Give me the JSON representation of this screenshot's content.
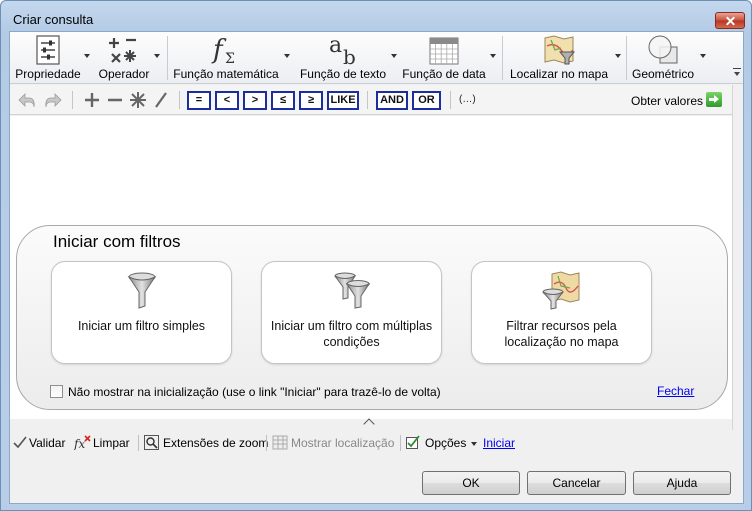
{
  "window": {
    "title": "Criar consulta"
  },
  "ribbon": {
    "items": [
      {
        "label": "Propriedade"
      },
      {
        "label": "Operador"
      },
      {
        "label": "Função matemática"
      },
      {
        "label": "Função de texto"
      },
      {
        "label": "Função de data"
      },
      {
        "label": "Localizar no mapa"
      },
      {
        "label": "Geométrico"
      }
    ]
  },
  "toolbar": {
    "operators": [
      "=",
      "<",
      ">",
      "≤",
      "≥",
      "LIKE"
    ],
    "logic": [
      "AND",
      "OR"
    ],
    "paren": "(…)",
    "get_values": "Obter valores"
  },
  "start_panel": {
    "title": "Iniciar com filtros",
    "cards": [
      {
        "text": "Iniciar um filtro simples"
      },
      {
        "text": "Iniciar um filtro com múltiplas condições"
      },
      {
        "text": "Filtrar recursos pela localização no mapa"
      }
    ],
    "checkbox_label": "Não mostrar na inicialização (use o link \"Iniciar\" para trazê-lo de volta)",
    "close_link": "Fechar"
  },
  "bottom_bar": {
    "validate": "Validar",
    "clear": "Limpar",
    "zoom": "Extensões de zoom",
    "show_location": "Mostrar localização",
    "options": "Opções",
    "start": "Iniciar"
  },
  "dialog": {
    "ok": "OK",
    "cancel": "Cancelar",
    "help": "Ajuda"
  }
}
